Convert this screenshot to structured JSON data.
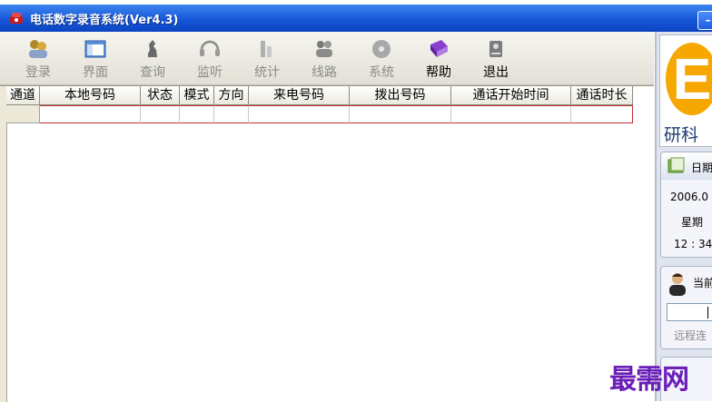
{
  "window": {
    "title": "电话数字录音系统(Ver4.3)"
  },
  "toolbar": {
    "buttons": [
      {
        "label": "登录",
        "icon": "login-users-icon",
        "enabled": false
      },
      {
        "label": "界面",
        "icon": "interface-window-icon",
        "enabled": false
      },
      {
        "label": "查询",
        "icon": "query-chess-icon",
        "enabled": false
      },
      {
        "label": "监听",
        "icon": "monitor-headset-icon",
        "enabled": false
      },
      {
        "label": "统计",
        "icon": "statistics-icon",
        "enabled": false
      },
      {
        "label": "线路",
        "icon": "line-users-icon",
        "enabled": false
      },
      {
        "label": "系统",
        "icon": "system-disc-icon",
        "enabled": false
      },
      {
        "label": "帮助",
        "icon": "help-book-icon",
        "enabled": true
      },
      {
        "label": "退出",
        "icon": "exit-icon",
        "enabled": true
      }
    ]
  },
  "grid": {
    "columns": [
      "通道",
      "本地号码",
      "状态",
      "模式",
      "方向",
      "来电号码",
      "拨出号码",
      "通话开始时间",
      "通话时长"
    ]
  },
  "sidebar": {
    "logo_text": "研科",
    "date_panel": {
      "title": "日期",
      "date": "2006.0",
      "weekday": "星期",
      "time": "12 : 34"
    },
    "user_panel": {
      "title": "当前",
      "remote_button": "远程连"
    }
  },
  "watermark": "最需网",
  "colors": {
    "titlebar": "#1657d8",
    "logo_accent": "#f6a800",
    "selected_row_border": "#c03030",
    "watermark": "#6b1fb8"
  }
}
